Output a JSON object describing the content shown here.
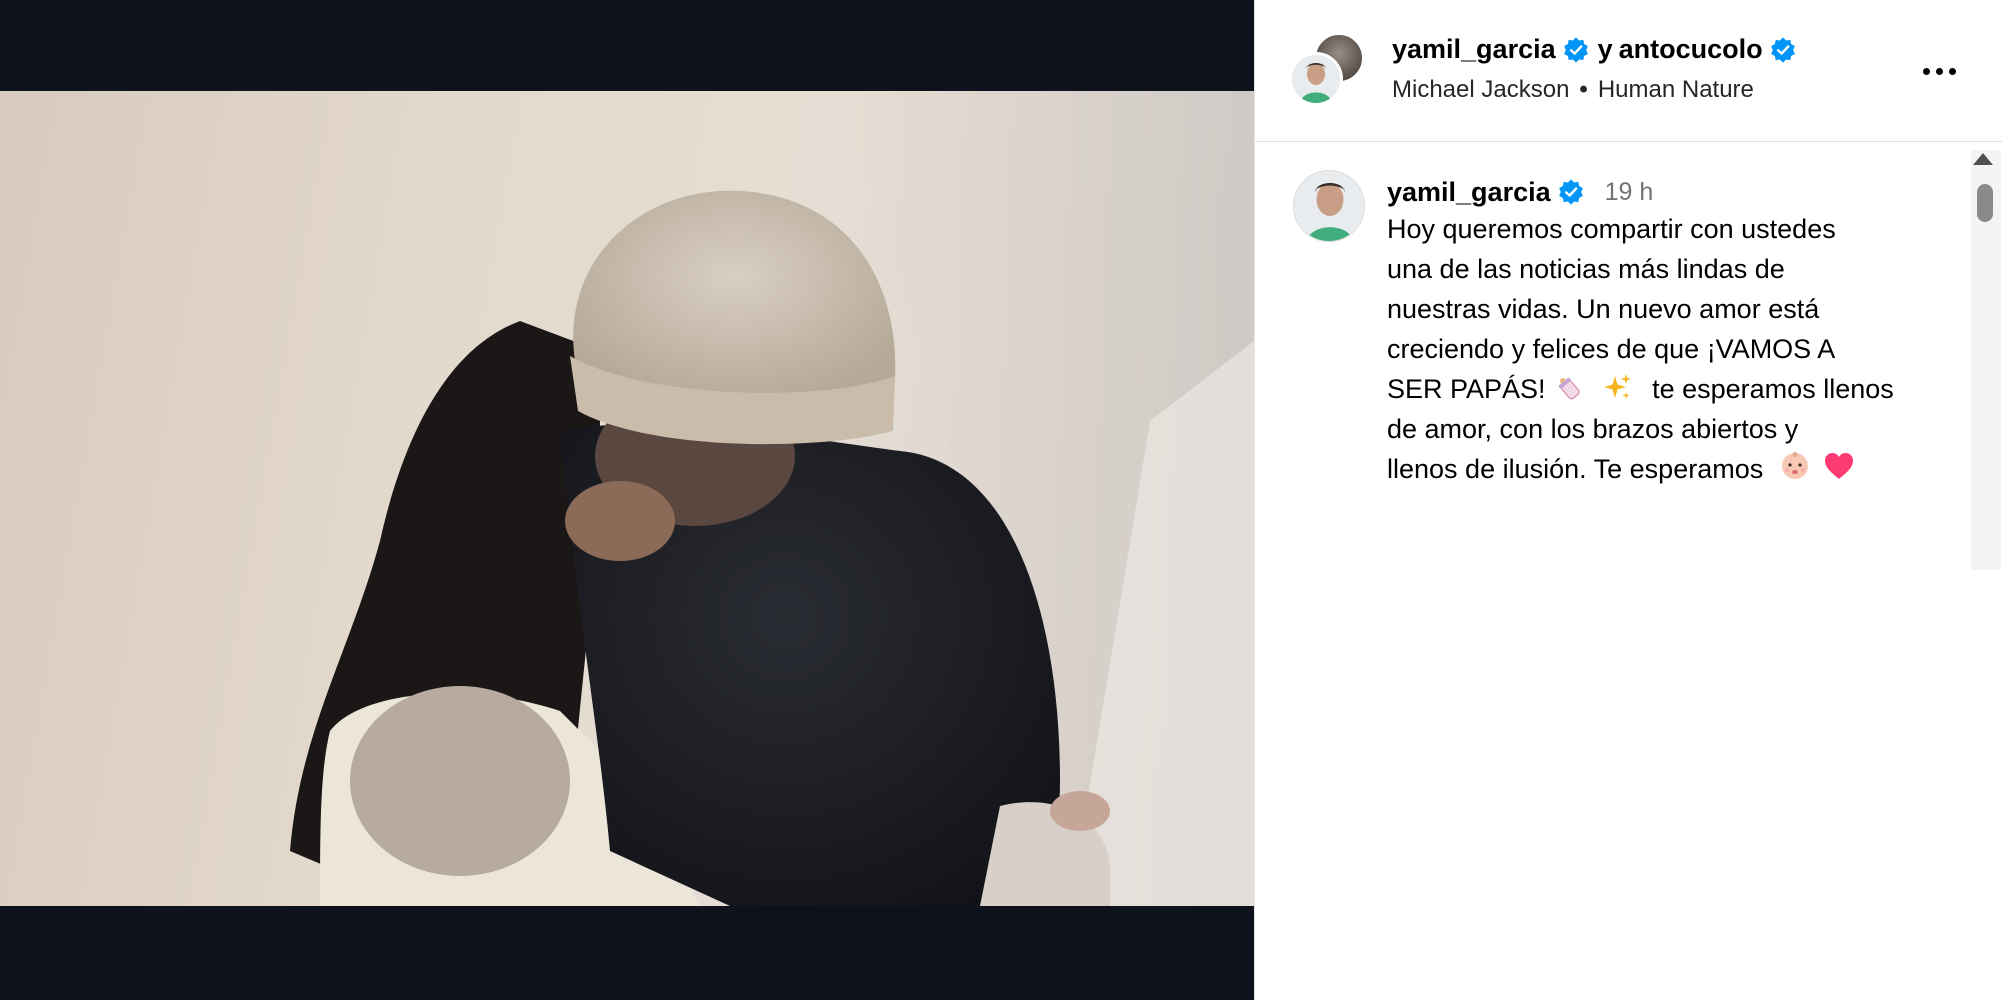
{
  "post": {
    "author": "yamil_garcia",
    "joiner": "y",
    "coauthor": "antocucolo",
    "audio": {
      "artist": "Michael Jackson",
      "separator": "•",
      "track": "Human Nature"
    }
  },
  "caption": {
    "author": "yamil_garcia",
    "time": "19 h",
    "lines": [
      "Hoy queremos compartir con ustedes",
      "una de las noticias más lindas de",
      "nuestras vidas. Un nuevo amor está",
      "creciendo y felices de que ¡VAMOS A",
      "SER PAPÁS!",
      "te esperamos llenos",
      "de amor, con los brazos abiertos y",
      "llenos de ilusión. Te esperamos"
    ],
    "emojis": [
      "baby-bottle-icon",
      "sparkles-icon",
      "baby-icon",
      "heart-icon"
    ]
  },
  "colors": {
    "verified": "#0095f6",
    "media_bg": "#0d121d",
    "heart": "#ff3b73",
    "sparkle": "#f7b521"
  },
  "icons": {
    "more": "more-options-icon",
    "verified": "verified-badge-icon",
    "mute": "speaker-icon"
  }
}
